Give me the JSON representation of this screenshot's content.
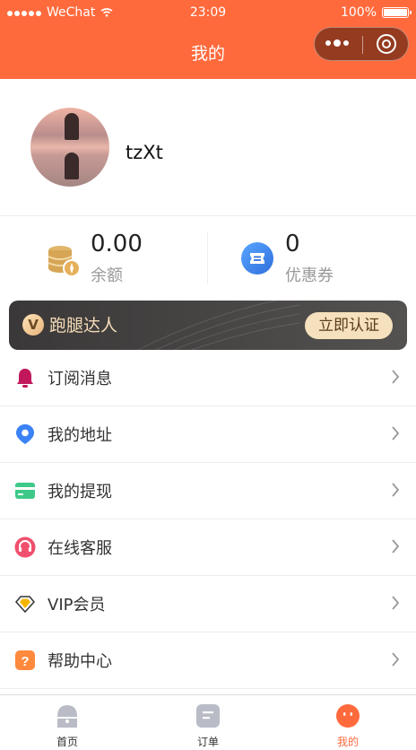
{
  "status_bar": {
    "carrier": "WeChat",
    "time": "23:09",
    "battery": "100%"
  },
  "nav": {
    "title": "我的"
  },
  "profile": {
    "username": "tzXt"
  },
  "stats": [
    {
      "value": "0.00",
      "label": "余额",
      "icon": "coins-icon"
    },
    {
      "value": "0",
      "label": "优惠券",
      "icon": "coupon-icon"
    }
  ],
  "banner": {
    "badge": "V",
    "title": "跑腿达人",
    "button": "立即认证"
  },
  "menu": [
    {
      "label": "订阅消息",
      "icon": "bell-icon",
      "color": "#c2185b"
    },
    {
      "label": "我的地址",
      "icon": "location-pin-icon",
      "color": "#3b82f6"
    },
    {
      "label": "我的提现",
      "icon": "wallet-card-icon",
      "color": "#3ec98a"
    },
    {
      "label": "在线客服",
      "icon": "headset-icon",
      "color": "#f0506e"
    },
    {
      "label": "VIP会员",
      "icon": "diamond-icon",
      "color": "#f5b400"
    },
    {
      "label": "帮助中心",
      "icon": "help-icon",
      "color": "#ff8a3d"
    }
  ],
  "tabbar": [
    {
      "label": "首页",
      "icon": "home-icon"
    },
    {
      "label": "订单",
      "icon": "order-icon"
    },
    {
      "label": "我的",
      "icon": "profile-icon",
      "active": true
    }
  ],
  "colors": {
    "brand": "#ff6a3d",
    "banner_bg": "#3a3838",
    "banner_accent": "#f5e1bd"
  }
}
